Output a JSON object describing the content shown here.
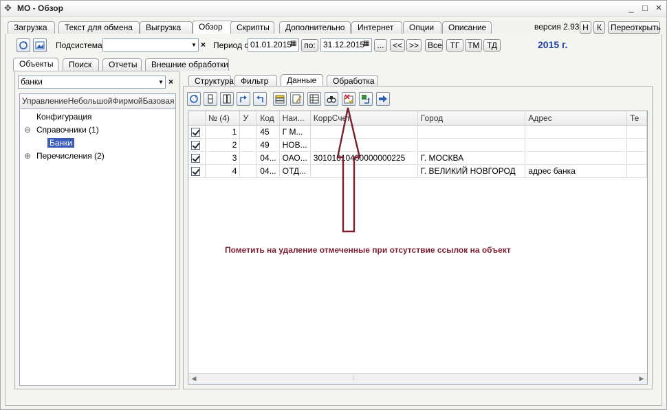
{
  "window": {
    "title": "МО - Обзор",
    "controls": {
      "minimize": "_",
      "maximize": "□",
      "close": "×"
    }
  },
  "main_tabs": [
    {
      "label": "Загрузка"
    },
    {
      "label": "Текст для обмена"
    },
    {
      "label": "Выгрузка"
    },
    {
      "label": "Обзор",
      "active": true
    },
    {
      "label": "Скрипты"
    },
    {
      "label": "Дополнительно"
    },
    {
      "label": "Интернет"
    },
    {
      "label": "Опции"
    },
    {
      "label": "Описание"
    }
  ],
  "header_right": {
    "version": "версия 2.93",
    "btn_h": "Н",
    "btn_k": "К",
    "reopen": "Переоткрыть"
  },
  "toolbar": {
    "subsystem_label": "Подсистема:",
    "subsystem_value": "",
    "period_label": "Период с:",
    "date_from": "01.01.2015",
    "to_label": "по:",
    "date_to": "31.12.2015",
    "ellipsis": "...",
    "prev": "<<",
    "next": ">>",
    "all": "Все",
    "tg": "ТГ",
    "tm": "ТМ",
    "td": "ТД",
    "year": "2015 г."
  },
  "left_tabs": [
    {
      "label": "Объекты",
      "active": true
    },
    {
      "label": "Поиск"
    },
    {
      "label": "Отчеты"
    },
    {
      "label": "Внешние обработки"
    }
  ],
  "left_search": {
    "value": "банки"
  },
  "tree": {
    "header": "УправлениеНебольшойФирмойБазовая",
    "items": [
      {
        "label": "Конфигурация"
      },
      {
        "label": "Справочники (1)",
        "toggle": "⊖"
      },
      {
        "label": "Банки",
        "selected": true
      },
      {
        "label": "Перечисления (2)",
        "toggle": "⊕"
      }
    ]
  },
  "right_tabs": [
    {
      "label": "Структура"
    },
    {
      "label": "Фильтр"
    },
    {
      "label": "Данные",
      "active": true
    },
    {
      "label": "Обработка"
    }
  ],
  "grid": {
    "columns": [
      "",
      "№ (4)",
      "У",
      "Код",
      "Наи...",
      "КоррСчет",
      "Город",
      "Адрес",
      "Те"
    ],
    "rows": [
      {
        "checked": true,
        "num": "1",
        "u": "",
        "code": "45",
        "name": "Г М...",
        "corr": "",
        "city": "",
        "address": ""
      },
      {
        "checked": true,
        "num": "2",
        "u": "",
        "code": "49",
        "name": "НОВ...",
        "corr": "",
        "city": "",
        "address": ""
      },
      {
        "checked": true,
        "num": "3",
        "u": "",
        "code": "04...",
        "name": "ОАО...",
        "corr": "30101810400000000225",
        "city": "Г. МОСКВА",
        "address": ""
      },
      {
        "checked": true,
        "num": "4",
        "u": "",
        "code": "04...",
        "name": "ОТД...",
        "corr": "",
        "city": "Г. ВЕЛИКИЙ НОВГОРОД",
        "address": "адрес банка"
      }
    ]
  },
  "annotation": "Пометить на удаление отмеченные при отсутствие ссылок на объект",
  "colors": {
    "accent_blue": "#1f3fa8",
    "annotation": "#7a1d2e",
    "selection": "#3a5bb8"
  }
}
